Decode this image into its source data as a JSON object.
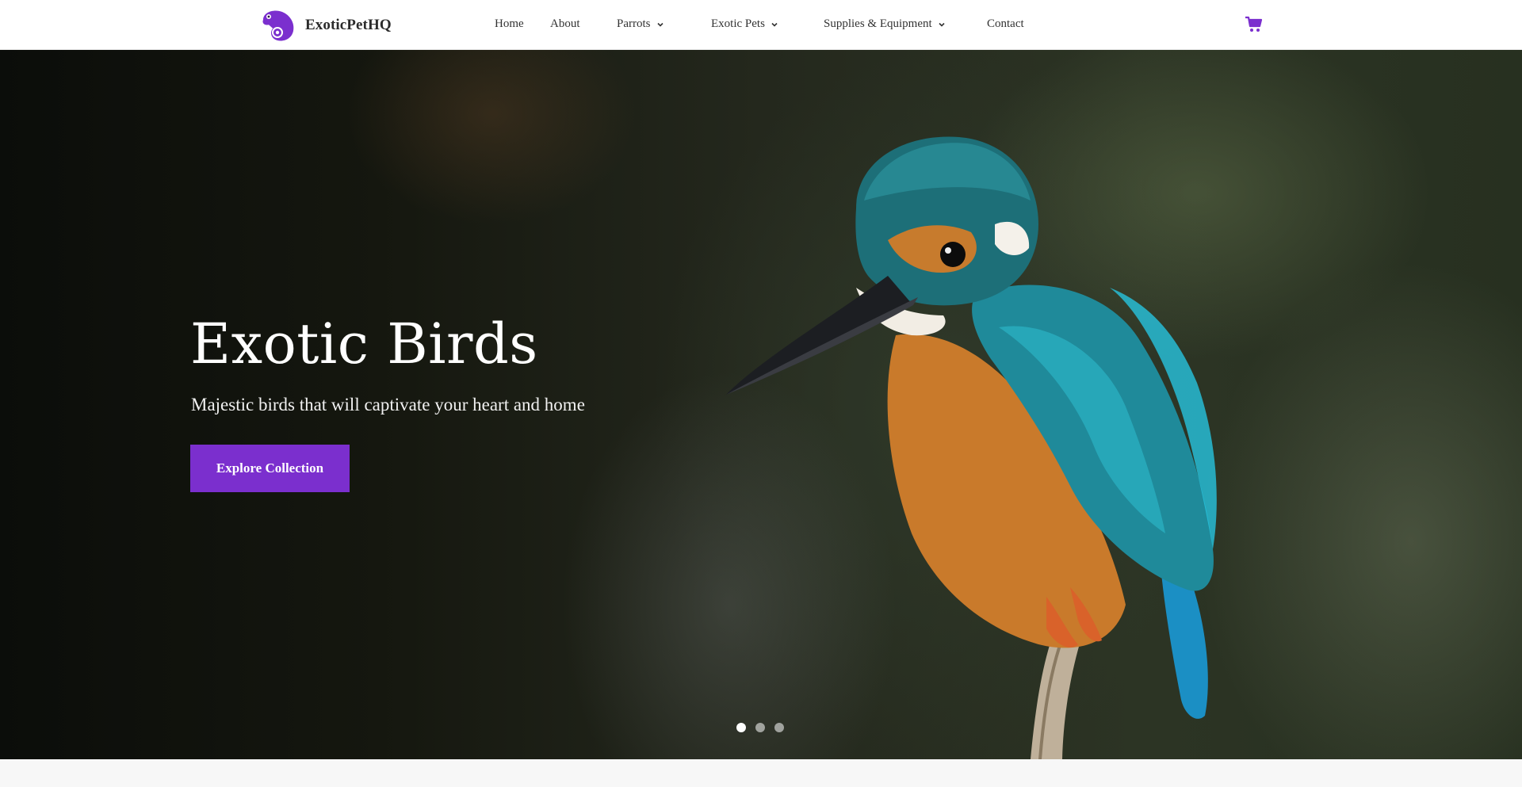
{
  "brand": {
    "name": "ExoticPetHQ",
    "logo_icon": "chameleon-icon",
    "accent": "#7b2fce"
  },
  "nav": {
    "home": "Home",
    "about": "About",
    "parrots": "Parrots",
    "exotic_pets": "Exotic Pets",
    "supplies": "Supplies & Equipment",
    "contact": "Contact",
    "dropdown_icon": "chevron-down-icon",
    "cart_icon": "cart-icon"
  },
  "hero": {
    "title": "Exotic Birds",
    "subtitle": "Majestic birds that will captivate your heart and home",
    "cta": "Explore Collection",
    "image": "kingfisher-photo",
    "slides": {
      "count": 3,
      "active": 1
    }
  }
}
